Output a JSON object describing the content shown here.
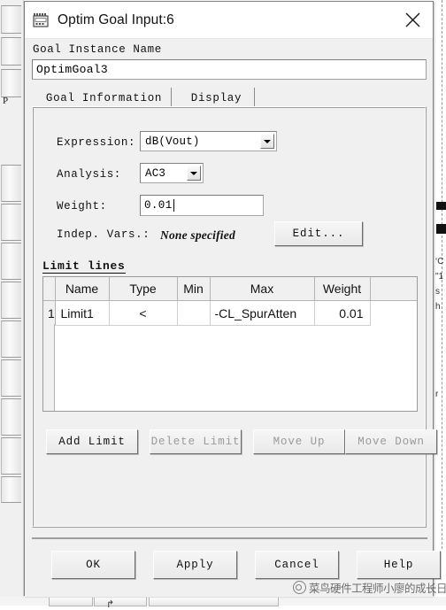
{
  "window": {
    "title": "Optim Goal Input:6",
    "icon": "optim-goal-icon",
    "close_label": "×"
  },
  "goal_instance": {
    "label": "Goal Instance Name",
    "value": "OptimGoal3",
    "placeholder": ""
  },
  "tabs": [
    {
      "id": "goal-information",
      "label": "Goal Information",
      "selected": true
    },
    {
      "id": "display",
      "label": "Display",
      "selected": false
    }
  ],
  "fields": {
    "expression": {
      "label": "Expression:",
      "value": "dB(Vout)",
      "options": [
        "dB(Vout)"
      ]
    },
    "analysis": {
      "label": "Analysis:",
      "value": "AC3",
      "options": [
        "AC3"
      ]
    },
    "weight": {
      "label": "Weight:",
      "value": "0.01"
    },
    "indep_vars": {
      "label": "Indep. Vars.:",
      "value": "None specified"
    },
    "edit_button": "Edit..."
  },
  "limit_lines": {
    "group_title": "Limit lines",
    "columns": [
      "",
      "Name",
      "Type",
      "Min",
      "Max",
      "Weight",
      ""
    ],
    "rows": [
      {
        "index": "1",
        "name": "Limit1",
        "type": "<",
        "min": "",
        "max": "-CL_SpurAtten",
        "weight": "0.01"
      }
    ],
    "buttons": [
      {
        "id": "add-limit",
        "label": "Add Limit",
        "enabled": true
      },
      {
        "id": "delete-limit",
        "label": "Delete Limit",
        "enabled": false
      },
      {
        "id": "move-up",
        "label": "Move Up",
        "enabled": false
      },
      {
        "id": "move-down",
        "label": "Move Down",
        "enabled": false
      }
    ]
  },
  "footer": {
    "ok": "OK",
    "apply": "Apply",
    "cancel": "Cancel",
    "help": "Help"
  },
  "watermark": {
    "text": "菜鸟硬件工程师小廖的成长日记"
  },
  "background": {
    "left_label": "P",
    "right_text_1": "‘C",
    "right_text_2": "\"1",
    "right_text_3": "s",
    "right_text_4": "h",
    "right_text_5": "r",
    "cursor": "↱"
  },
  "colors": {
    "dialog_face": "#f0f0f0",
    "titlebar": "#ffffff",
    "field_bg": "#ffffff",
    "border": "#9d9d9d",
    "text": "#111111",
    "disabled_text": "#9a9a9a"
  }
}
